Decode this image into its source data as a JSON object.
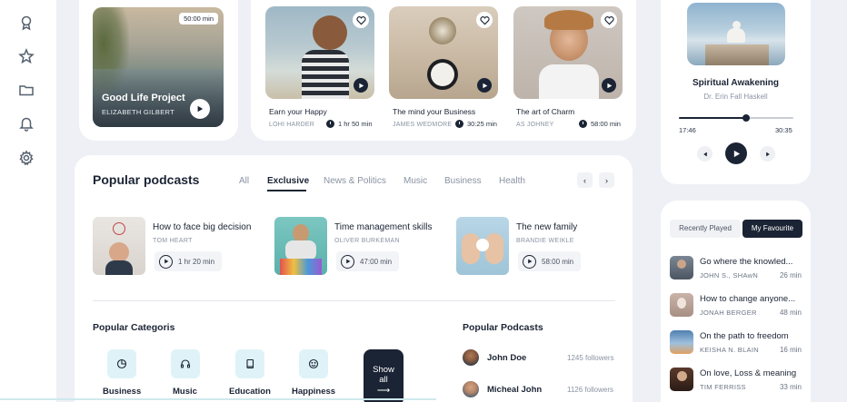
{
  "colors": {
    "accent": "#1b2434",
    "teal_tile": "#dff2f7",
    "background": "#eef0f5"
  },
  "sidebar": {
    "icons": [
      "award-icon",
      "star-icon",
      "folder-icon",
      "bell-icon",
      "gear-icon"
    ]
  },
  "featured": {
    "duration": "50:00 min",
    "title": "Good Life Project",
    "author": "ELIZABETH GILBERT"
  },
  "top_cards": [
    {
      "title": "Earn your Happy",
      "author": "LOHI HARDER",
      "duration": "1 hr 50 min"
    },
    {
      "title": "The mind your Business",
      "author": "JAMES WEDMORE",
      "duration": "30:25 min"
    },
    {
      "title": "The art of Charm",
      "author": "AS JOHNEY",
      "duration": "58:00 min"
    }
  ],
  "player": {
    "title": "Spiritual Awakening",
    "author": "Dr. Erin Fall Haskell",
    "elapsed": "17:46",
    "total": "30:35",
    "progress": 0.59
  },
  "popular": {
    "heading": "Popular podcasts",
    "tabs": [
      "All",
      "Exclusive",
      "News & Politics",
      "Music",
      "Business",
      "Health"
    ],
    "active_tab": "Exclusive",
    "items": [
      {
        "title": "How to face big decision",
        "author": "TOM HEART",
        "duration": "1 hr  20 min"
      },
      {
        "title": "Time management skills",
        "author": "OLIVER BURKEMAN",
        "duration": "47:00 min"
      },
      {
        "title": "The new family",
        "author": "BRANDIE WEIKLE",
        "duration": "58:00 min"
      }
    ]
  },
  "categories": {
    "heading": "Popular Categoris",
    "items": [
      {
        "label": "Business",
        "icon": "pie-chart-icon"
      },
      {
        "label": "Music",
        "icon": "headphones-icon"
      },
      {
        "label": "Education",
        "icon": "book-icon"
      },
      {
        "label": "Happiness",
        "icon": "smile-icon"
      }
    ],
    "show_all": "Show all",
    "show_all_arrow": "⟶"
  },
  "popular_podcasters": {
    "heading": "Popular Podcasts",
    "items": [
      {
        "name": "John Doe",
        "followers": "1245 followers"
      },
      {
        "name": "Micheal John",
        "followers": "1126 followers"
      }
    ]
  },
  "favourites": {
    "tabs": [
      "Recently Played",
      "My Favourite"
    ],
    "active_tab": "My Favourite",
    "items": [
      {
        "title": "Go where the knowled...",
        "author": "JOHN S., SHAwN",
        "duration": "26 min"
      },
      {
        "title": "How to change anyone...",
        "author": "JONAH BERGER",
        "duration": "48 min"
      },
      {
        "title": "On the path to freedom",
        "author": "KEISHA N. BLAIN",
        "duration": "16 min"
      },
      {
        "title": "On love, Loss & meaning",
        "author": "TIM FERRISS",
        "duration": "33 min"
      }
    ]
  }
}
